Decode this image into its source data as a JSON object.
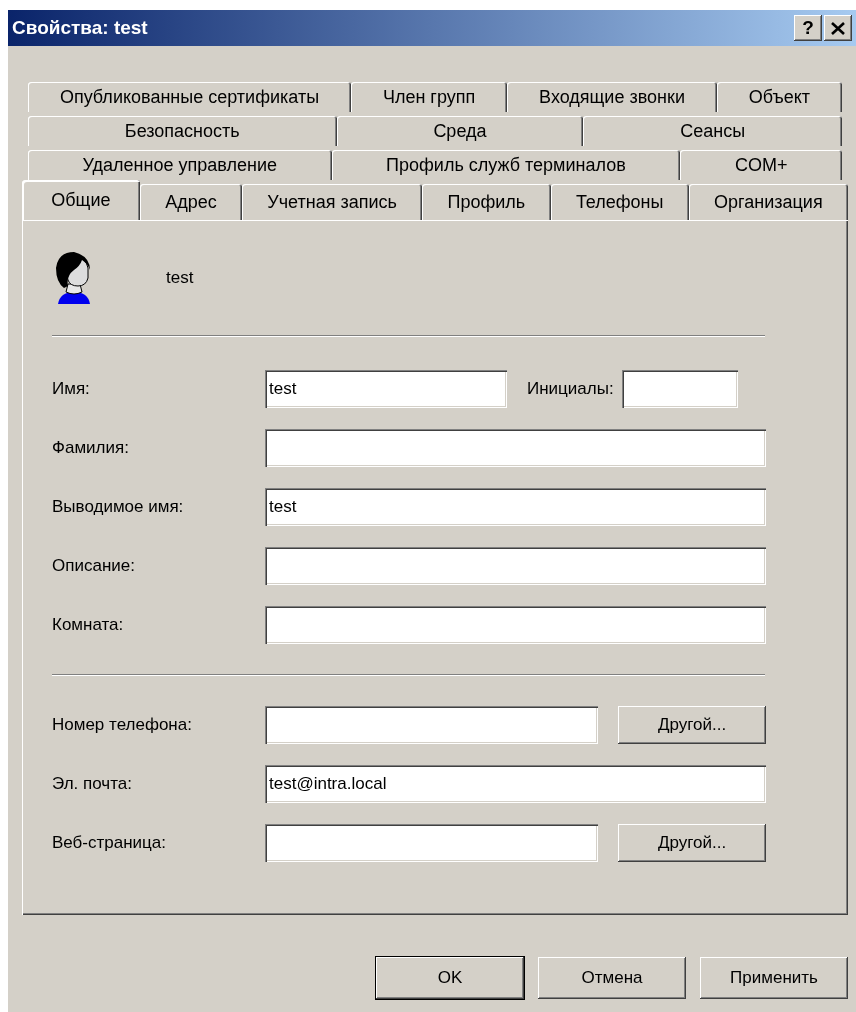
{
  "window": {
    "title": "Свойства: test",
    "help_label": "?"
  },
  "tab_rows": [
    [
      {
        "label": "Опубликованные сертификаты",
        "selected": false
      },
      {
        "label": "Член групп",
        "selected": false
      },
      {
        "label": "Входящие звонки",
        "selected": false
      },
      {
        "label": "Объект",
        "selected": false
      }
    ],
    [
      {
        "label": "Безопасность",
        "selected": false
      },
      {
        "label": "Среда",
        "selected": false
      },
      {
        "label": "Сеансы",
        "selected": false
      }
    ],
    [
      {
        "label": "Удаленное управление",
        "selected": false
      },
      {
        "label": "Профиль служб терминалов",
        "selected": false
      },
      {
        "label": "COM+",
        "selected": false
      }
    ],
    [
      {
        "label": "Общие",
        "selected": true
      },
      {
        "label": "Адрес",
        "selected": false
      },
      {
        "label": "Учетная запись",
        "selected": false
      },
      {
        "label": "Профиль",
        "selected": false
      },
      {
        "label": "Телефоны",
        "selected": false
      },
      {
        "label": "Организация",
        "selected": false
      }
    ]
  ],
  "header": {
    "name": "test"
  },
  "sections": [
    {
      "rows": [
        {
          "kind": "name",
          "label": "Имя:",
          "value": "test",
          "initials": {
            "label": "Инициалы:"
          }
        },
        {
          "kind": "text",
          "label": "Фамилия:"
        },
        {
          "kind": "text",
          "label": "Выводимое имя:",
          "value": "test"
        },
        {
          "kind": "text",
          "label": "Описание:"
        },
        {
          "kind": "text",
          "label": "Комната:"
        }
      ]
    },
    {
      "rows": [
        {
          "kind": "with_button",
          "label": "Номер телефона:",
          "button": {
            "label": "Другой..."
          }
        },
        {
          "kind": "text",
          "label": "Эл. почта:",
          "value": "test@intra.local"
        },
        {
          "kind": "with_button",
          "label": "Веб-страница:",
          "button": {
            "label": "Другой..."
          }
        }
      ]
    }
  ],
  "buttons": [
    {
      "label": "OK"
    },
    {
      "label": "Отмена"
    },
    {
      "label": "Применить"
    }
  ]
}
